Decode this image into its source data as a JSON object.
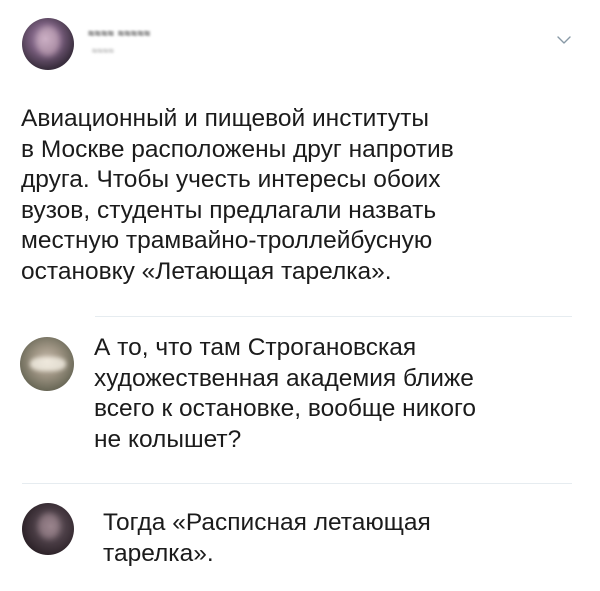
{
  "tweet": {
    "author": {
      "display_name": "≈≈≈≈ ≈≈≈≈≈",
      "handle": "≈≈≈≈",
      "avatar": "blurred-profile-photo"
    },
    "menu_icon": "chevron-down-icon",
    "text": "Авиационный и пищевой институты\nв Москве расположены друг напротив\nдруга. Чтобы учесть интересы обоих\nвузов, студенты предлагали назвать\nместную трамвайно-троллейбусную\nостановку «Летающая тарелка»."
  },
  "replies": [
    {
      "avatar": "blurred-profile-photo",
      "text": "А то, что там Строгановская\nхудожественная академия ближе\nвсего к остановке, вообще никого\nне колышет?"
    },
    {
      "avatar": "blurred-profile-photo",
      "text": "Тогда «Расписная летающая\nтарелка»."
    }
  ],
  "colors": {
    "text": "#1b1b1b",
    "divider": "#e6ecf0",
    "icon": "#8899a6"
  }
}
